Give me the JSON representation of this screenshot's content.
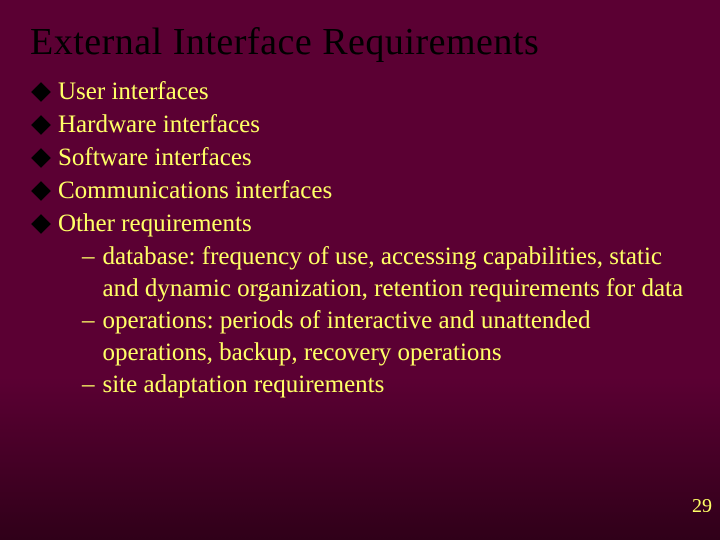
{
  "title": "External Interface Requirements",
  "bullets": [
    "User interfaces",
    "Hardware interfaces",
    "Software interfaces",
    "Communications interfaces",
    "Other requirements"
  ],
  "subbullets": [
    "database: frequency of use, accessing capabilities, static and dynamic organization, retention requirements for data",
    "operations: periods of interactive and unattended operations, backup, recovery operations",
    "site adaptation requirements"
  ],
  "page_number": "29"
}
